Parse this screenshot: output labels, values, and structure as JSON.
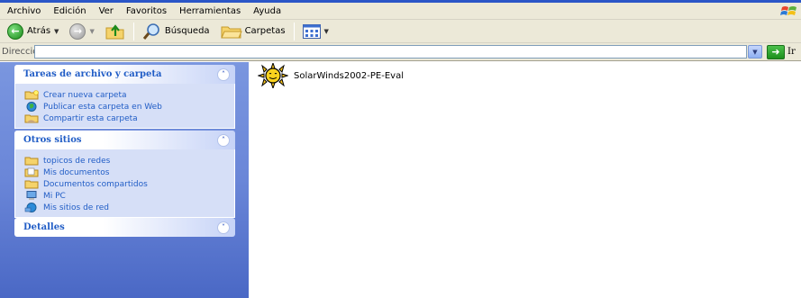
{
  "menubar": {
    "items": [
      "Archivo",
      "Edición",
      "Ver",
      "Favoritos",
      "Herramientas",
      "Ayuda"
    ]
  },
  "toolbar": {
    "back_label": "Atrás",
    "search_label": "Búsqueda",
    "folders_label": "Carpetas"
  },
  "addressbar": {
    "label": "Dirección",
    "value": "",
    "go_label": "Ir"
  },
  "sidebar": {
    "file_tasks": {
      "title": "Tareas de archivo y carpeta",
      "items": [
        {
          "label": "Crear nueva carpeta",
          "icon": "new-folder-icon"
        },
        {
          "label": "Publicar esta carpeta en Web",
          "icon": "globe-icon"
        },
        {
          "label": "Compartir esta carpeta",
          "icon": "share-folder-icon"
        }
      ]
    },
    "other_places": {
      "title": "Otros sitios",
      "items": [
        {
          "label": "topicos de redes",
          "icon": "folder-icon"
        },
        {
          "label": "Mis documentos",
          "icon": "my-documents-icon"
        },
        {
          "label": "Documentos compartidos",
          "icon": "folder-icon"
        },
        {
          "label": "Mi PC",
          "icon": "my-computer-icon"
        },
        {
          "label": "Mis sitios de red",
          "icon": "network-places-icon"
        }
      ]
    },
    "details": {
      "title": "Detalles"
    }
  },
  "content": {
    "files": [
      {
        "name": "SolarWinds2002-PE-Eval",
        "icon": "sun-installer-icon"
      }
    ]
  },
  "colors": {
    "sidebar_top": "#7a96df",
    "sidebar_bottom": "#4a68c5",
    "panel_title": "#215dc6",
    "panel_body": "#d6dff7",
    "chrome": "#ece9d8"
  }
}
